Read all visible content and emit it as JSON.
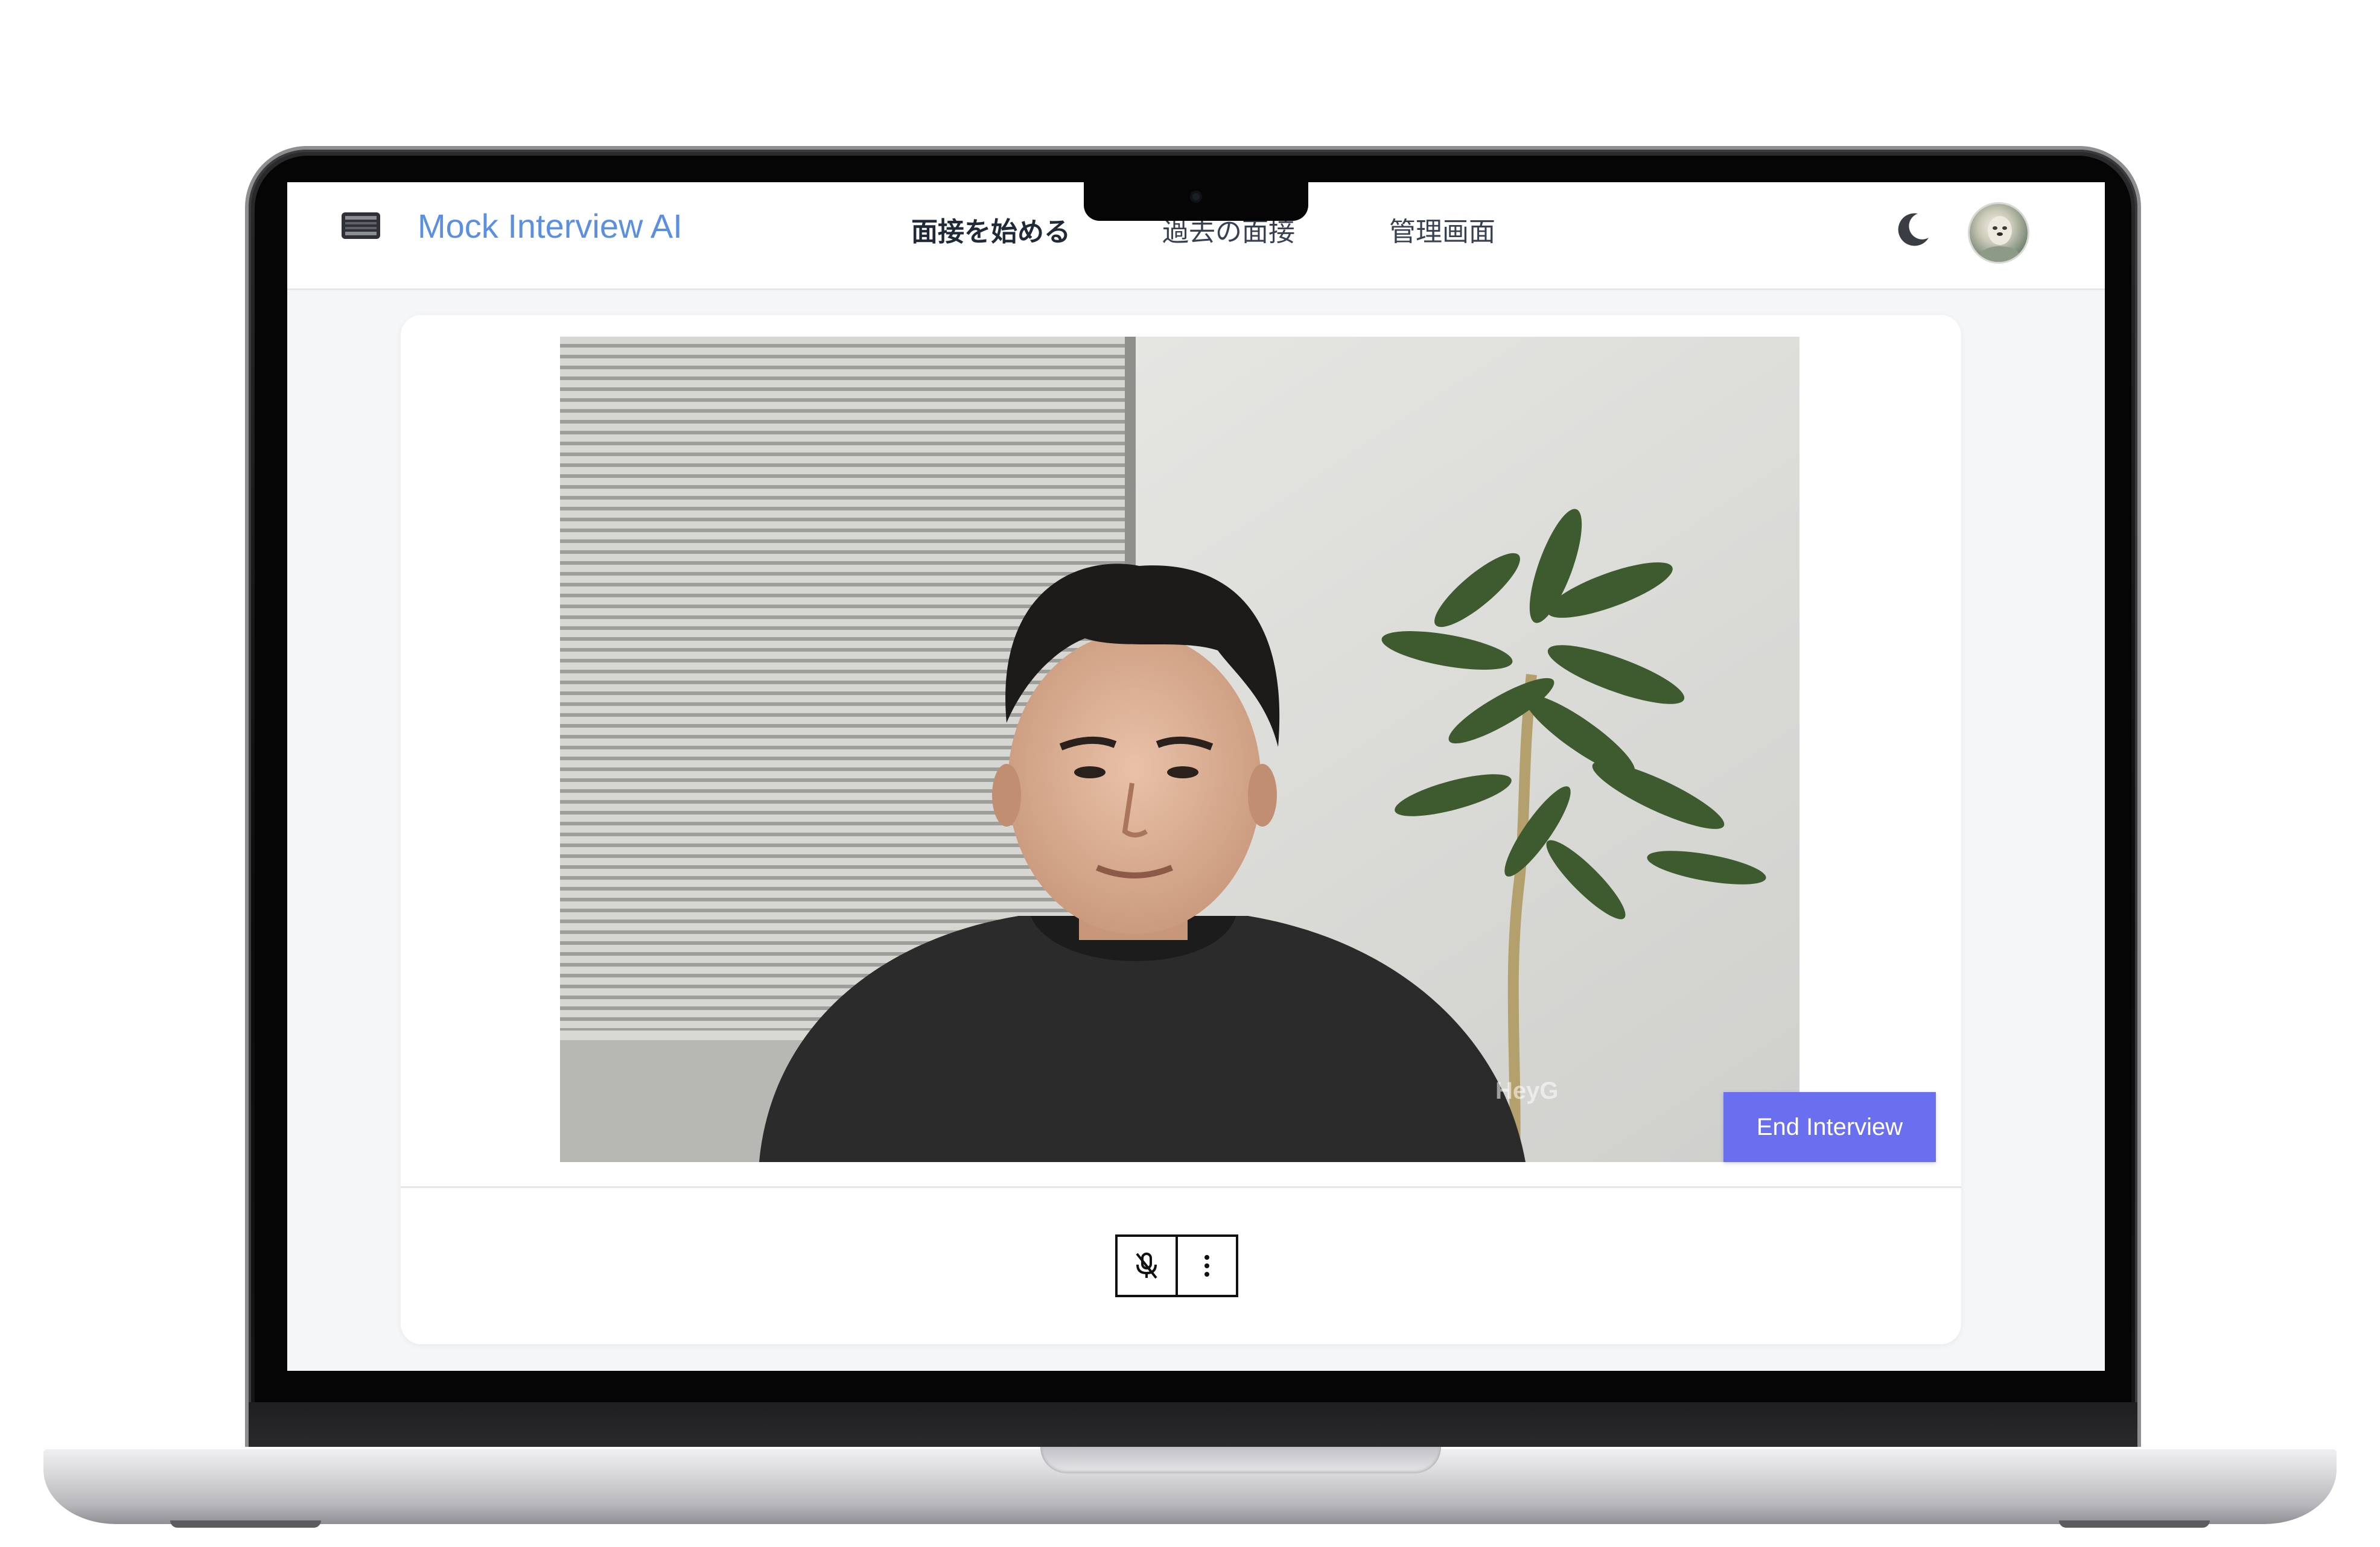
{
  "app": {
    "title": "Mock Interview AI"
  },
  "nav": {
    "items": [
      {
        "label": "面接を始める",
        "active": true
      },
      {
        "label": "過去の面接",
        "active": false
      },
      {
        "label": "管理画面",
        "active": false
      }
    ]
  },
  "header": {
    "theme_icon": "moon-icon",
    "avatar_icon": "user-avatar"
  },
  "video": {
    "watermark": "HeyG"
  },
  "actions": {
    "end_label": "End Interview"
  },
  "controls": {
    "mic_icon": "mic-muted-icon",
    "more_icon": "more-vertical-icon"
  },
  "colors": {
    "accent": "#6a6ff0",
    "title": "#5b8fe0",
    "screen_bg": "#f5f6f8"
  }
}
